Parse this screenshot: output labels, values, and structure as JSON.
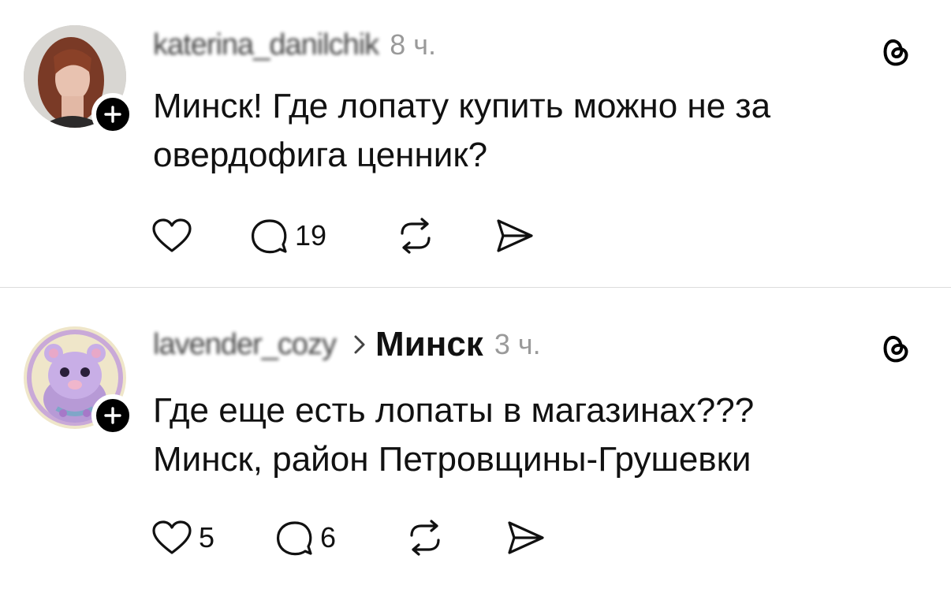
{
  "posts": [
    {
      "username": "katerina_danilchik",
      "time": "8 ч.",
      "topic": "",
      "text_lines": [
        "Минск! Где лопату купить можно не за",
        "овердофига ценник?"
      ],
      "likes": "",
      "replies": "19"
    },
    {
      "username": "lavender_cozy",
      "time": "3 ч.",
      "topic": "Минск",
      "text_lines": [
        "Где еще есть лопаты в магазинах???",
        "Минск, район Петровщины-Грушевки"
      ],
      "likes": "5",
      "replies": "6"
    }
  ],
  "icons": {
    "like": "heart-icon",
    "reply": "comment-icon",
    "repost": "repost-icon",
    "share": "send-icon",
    "app": "threads-logo-icon",
    "follow": "plus-icon"
  }
}
